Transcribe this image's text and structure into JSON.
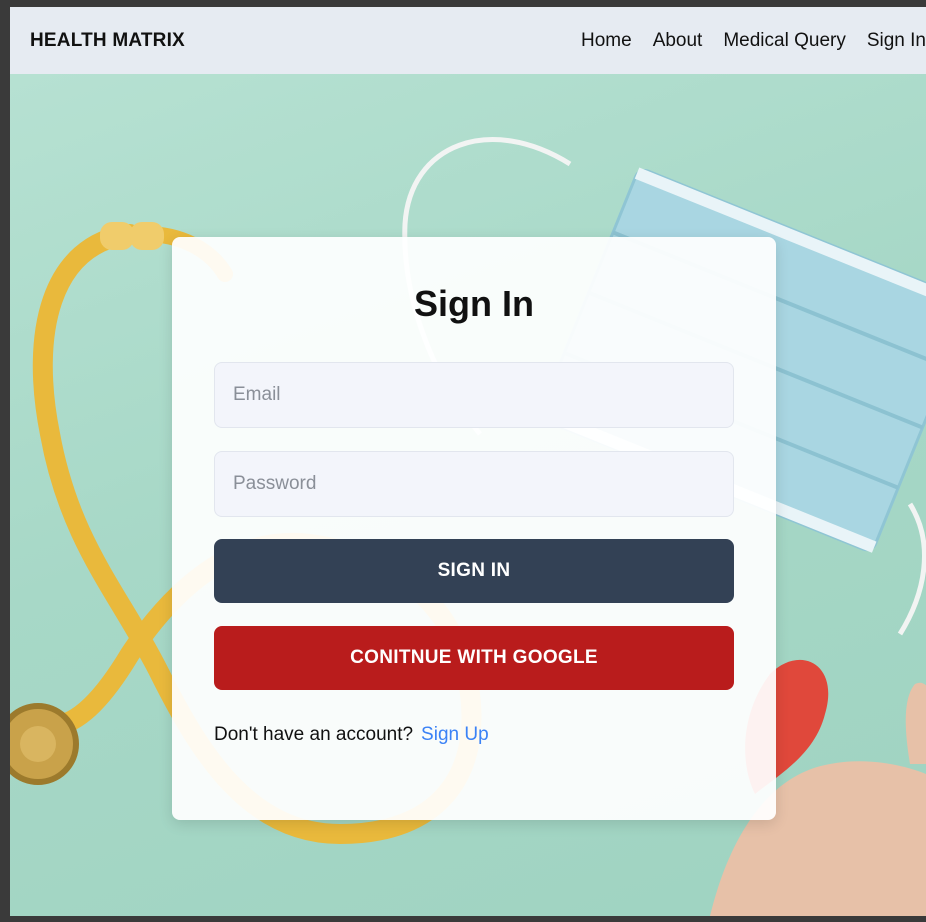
{
  "navbar": {
    "brand": "HEALTH MATRIX",
    "links": [
      "Home",
      "About",
      "Medical Query",
      "Sign In"
    ]
  },
  "form": {
    "title": "Sign In",
    "email_placeholder": "Email",
    "password_placeholder": "Password",
    "signin_button": "SIGN IN",
    "google_button": "CONITNUE WITH GOOGLE",
    "no_account_text": "Don't have an account?",
    "signup_link": "Sign Up"
  },
  "colors": {
    "navbar_bg": "#e6ebf2",
    "signin_button": "#334155",
    "google_button": "#b91c1c",
    "link": "#3b82f6",
    "background": "#a9d8c8"
  }
}
